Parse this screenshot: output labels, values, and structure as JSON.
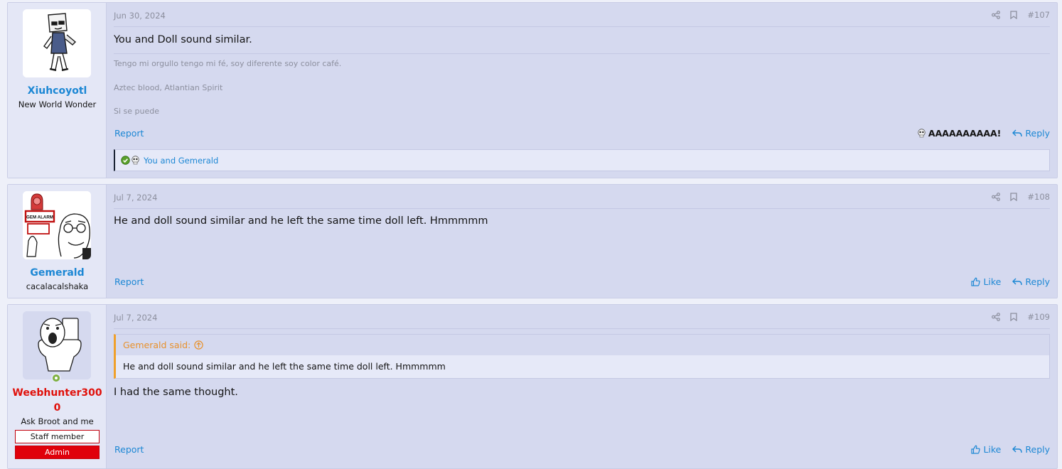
{
  "posts": [
    {
      "date": "Jun 30, 2024",
      "number": "#107",
      "user": {
        "name": "Xiuhcoyotl",
        "title": "New World Wonder"
      },
      "body": "You and Doll sound similar.",
      "signature": [
        "Tengo mi orgullo tengo mi fé, soy diferente soy color café.",
        "Aztec blood, Atlantian Spirit",
        "Si se puede"
      ],
      "report": "Report",
      "reaction_label": "AAAAAAAAAA!",
      "reply": "Reply",
      "reactions_text": "You and Gemerald"
    },
    {
      "date": "Jul 7, 2024",
      "number": "#108",
      "user": {
        "name": "Gemerald",
        "title": "cacalacalshaka",
        "avatar_text": "GEM ALARM"
      },
      "body": "He and doll sound similar and he left the same time doll left. Hmmmmm",
      "report": "Report",
      "like": "Like",
      "reply": "Reply"
    },
    {
      "date": "Jul 7, 2024",
      "number": "#109",
      "user": {
        "name": "Weebhunter3000",
        "title": "Ask Broot and me",
        "banner_staff": "Staff member",
        "banner_admin": "Admin"
      },
      "quote": {
        "author": "Gemerald said:",
        "text": "He and doll sound similar and he left the same time doll left. Hmmmmm"
      },
      "body": "I had the same thought.",
      "report": "Report",
      "like": "Like",
      "reply": "Reply"
    }
  ],
  "colors": {
    "link": "#1c87d4",
    "staff_name": "#e0110b",
    "quote_accent": "#f0a02a",
    "post_bg": "#d5d9ef"
  }
}
